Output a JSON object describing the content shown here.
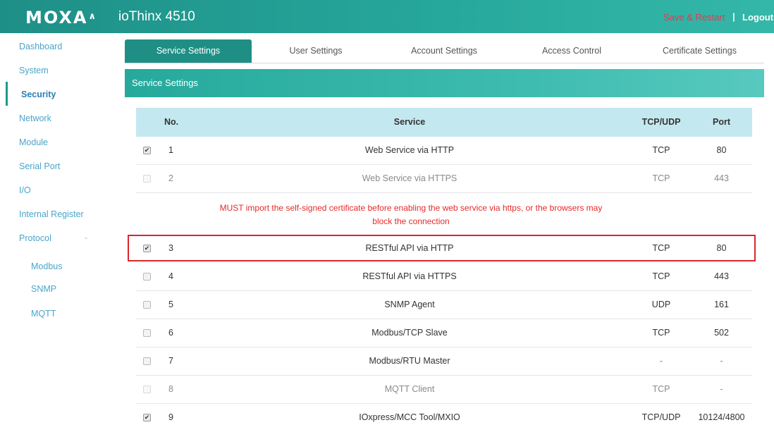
{
  "header": {
    "logo": "MOXA",
    "product": "ioThinx 4510",
    "save_restart": "Save & Restart",
    "separator": "|",
    "logout": "Logout"
  },
  "sidebar": {
    "items": [
      {
        "label": "Dashboard"
      },
      {
        "label": "System"
      },
      {
        "label": "Security"
      },
      {
        "label": "Network"
      },
      {
        "label": "Module"
      },
      {
        "label": "Serial Port"
      },
      {
        "label": "I/O"
      },
      {
        "label": "Internal Register"
      },
      {
        "label": "Protocol"
      }
    ],
    "protocol_toggle": "-",
    "sub_items": [
      {
        "label": "Modbus"
      },
      {
        "label": "SNMP"
      },
      {
        "label": "MQTT"
      }
    ]
  },
  "tabs": [
    {
      "label": "Service Settings"
    },
    {
      "label": "User Settings"
    },
    {
      "label": "Account Settings"
    },
    {
      "label": "Access Control"
    },
    {
      "label": "Certificate Settings"
    }
  ],
  "panel": {
    "title": "Service Settings",
    "columns": {
      "no": "No.",
      "service": "Service",
      "protocol": "TCP/UDP",
      "port": "Port"
    },
    "warning_line1": "MUST import the self-signed certificate before enabling the web service via https, or the browsers may",
    "warning_line2": "block the connection",
    "rows": [
      {
        "no": "1",
        "service": "Web Service via HTTP",
        "protocol": "TCP",
        "port": "80",
        "checked": true
      },
      {
        "no": "2",
        "service": "Web Service via HTTPS",
        "protocol": "TCP",
        "port": "443",
        "checked": false
      },
      {
        "no": "3",
        "service": "RESTful API via HTTP",
        "protocol": "TCP",
        "port": "80",
        "checked": true
      },
      {
        "no": "4",
        "service": "RESTful API via HTTPS",
        "protocol": "TCP",
        "port": "443",
        "checked": false
      },
      {
        "no": "5",
        "service": "SNMP Agent",
        "protocol": "UDP",
        "port": "161",
        "checked": false
      },
      {
        "no": "6",
        "service": "Modbus/TCP Slave",
        "protocol": "TCP",
        "port": "502",
        "checked": false
      },
      {
        "no": "7",
        "service": "Modbus/RTU Master",
        "protocol": "-",
        "port": "-",
        "checked": false
      },
      {
        "no": "8",
        "service": "MQTT Client",
        "protocol": "TCP",
        "port": "-",
        "checked": false
      },
      {
        "no": "9",
        "service": "IOxpress/MCC Tool/MXIO",
        "protocol": "TCP/UDP",
        "port": "10124/4800",
        "checked": true
      }
    ]
  },
  "colors": {
    "header_teal": "#26a79b",
    "tab_active": "#1f8f86",
    "table_header": "#c4e8ef",
    "warning_red": "#e52a2a",
    "save_restart_red": "#e8384f",
    "sidebar_link": "#4aa5c9"
  }
}
